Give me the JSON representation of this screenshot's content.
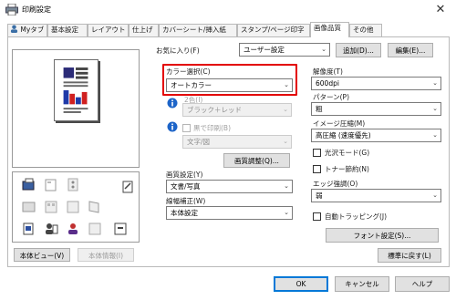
{
  "window": {
    "title": "印刷設定",
    "close_glyph": "✕"
  },
  "tabs": [
    {
      "label": "Myタブ"
    },
    {
      "label": "基本設定"
    },
    {
      "label": "レイアウト"
    },
    {
      "label": "仕上げ"
    },
    {
      "label": "カバーシート/挿入紙"
    },
    {
      "label": "スタンプ/ページ印字"
    },
    {
      "label": "画像品質"
    },
    {
      "label": "その他"
    }
  ],
  "active_tab": "画像品質",
  "favorites": {
    "label": "お気に入り(F)",
    "value": "ユーザー設定",
    "add_label": "追加(D)...",
    "edit_label": "編集(E)..."
  },
  "preview": {
    "view_button": "本体ビュー(V)",
    "info_button": "本体情報(I)"
  },
  "color_select": {
    "label": "カラー選択(C)",
    "value": "オートカラー"
  },
  "two_color": {
    "label": "2色(I)",
    "value": "ブラック＋レッド"
  },
  "black_print": {
    "label": "黒で印刷(B)",
    "value": "文字/図"
  },
  "image_adjust_button": "画質調整(Q)...",
  "quality": {
    "label": "画質設定(Y)",
    "value": "文書/写真"
  },
  "line_width": {
    "label": "線幅補正(W)",
    "value": "本体設定"
  },
  "resolution": {
    "label": "解像度(T)",
    "value": "600dpi"
  },
  "pattern": {
    "label": "パターン(P)",
    "value": "粗"
  },
  "compression": {
    "label": "イメージ圧縮(M)",
    "value": "高圧縮 (速度優先)"
  },
  "gloss_label": "光沢モード(G)",
  "toner_label": "トナー節約(N)",
  "edge": {
    "label": "エッジ強調(O)",
    "value": "弱"
  },
  "auto_trapping_label": "自動トラッピング(J)",
  "font_settings_button": "フォント設定(S)...",
  "restore_button": "標準に戻す(L)",
  "footer": {
    "ok": "OK",
    "cancel": "キャンセル",
    "help": "ヘルプ"
  },
  "colors": {
    "highlight": "#e30000",
    "focus_border": "#0078d7",
    "panel_border": "#b9b9b9"
  },
  "icons": [
    "printer-icon",
    "user-icon",
    "info-icon",
    "chevron-down-icon",
    "paper-tray-icon",
    "stamp-icon",
    "layout-icon",
    "output-tray-icon",
    "close-icon"
  ]
}
